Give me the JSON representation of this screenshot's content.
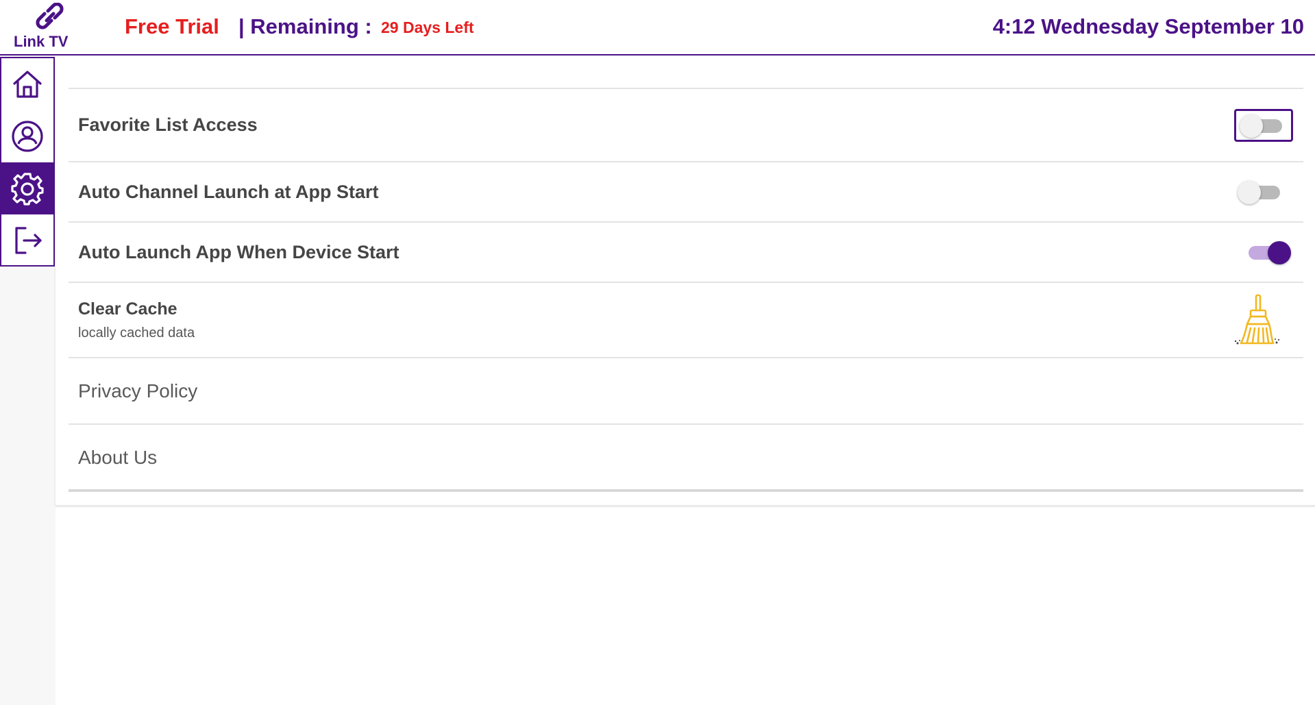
{
  "header": {
    "logo_text": "Link TV",
    "trial_label": "Free Trial",
    "remaining_label": "| Remaining :",
    "days_left": "29 Days Left",
    "clock": "4:12 Wednesday September 10"
  },
  "sidebar": {
    "items": [
      {
        "name": "home",
        "icon": "home-icon",
        "active": false
      },
      {
        "name": "account",
        "icon": "user-icon",
        "active": false
      },
      {
        "name": "settings",
        "icon": "gear-icon",
        "active": true
      },
      {
        "name": "logout",
        "icon": "logout-icon",
        "active": false
      }
    ]
  },
  "settings": {
    "favorite_list_access": {
      "label": "Favorite List Access",
      "enabled": false,
      "focused": true
    },
    "auto_channel_launch": {
      "label": "Auto Channel Launch at App Start",
      "enabled": false
    },
    "auto_launch_app": {
      "label": "Auto Launch App When Device Start",
      "enabled": true
    },
    "clear_cache": {
      "label": "Clear Cache",
      "sublabel": "locally cached data",
      "icon": "broom-icon"
    },
    "privacy_policy": {
      "label": "Privacy Policy"
    },
    "about_us": {
      "label": "About Us"
    }
  },
  "colors": {
    "brand": "#4b1287",
    "alert": "#e61e1e",
    "toggle_on_track": "#c4a8e0",
    "broom": "#f2b820"
  }
}
